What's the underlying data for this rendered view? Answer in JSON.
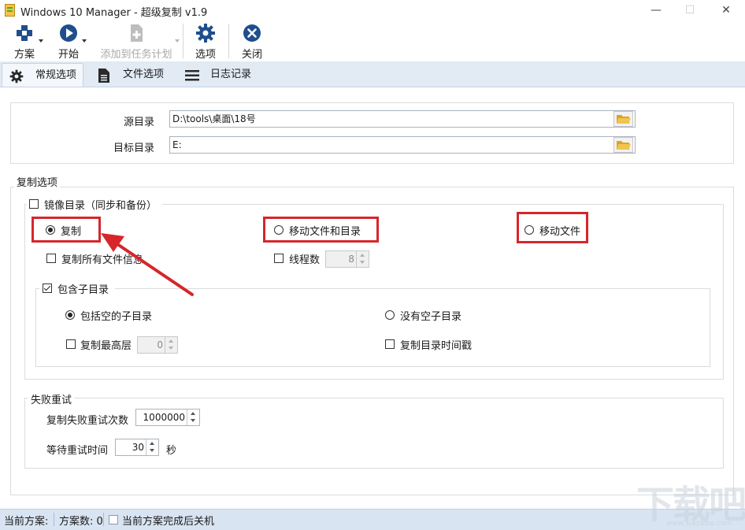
{
  "window": {
    "title": "Windows 10 Manager - 超级复制 v1.9",
    "minimize": "—",
    "maximize": "☐",
    "close": "✕"
  },
  "toolbar": {
    "scheme": "方案",
    "start": "开始",
    "add_task": "添加到任务计划",
    "options": "选项",
    "close": "关闭"
  },
  "tabs": {
    "general": "常规选项",
    "file_options": "文件选项",
    "log": "日志记录"
  },
  "paths": {
    "source_label": "源目录",
    "source_value": "D:\\tools\\桌面\\18号",
    "target_label": "目标目录",
    "target_value": "E:"
  },
  "copy_options": {
    "group_title": "复制选项",
    "mirror": "镜像目录（同步和备份）",
    "mode_copy": "复制",
    "mode_move_files_dirs": "移动文件和目录",
    "mode_move_files": "移动文件",
    "copy_all_info": "复制所有文件信息",
    "threads_label": "线程数",
    "threads_value": "8",
    "include_subdirs": "包含子目录",
    "include_empty": "包括空的子目录",
    "no_empty": "没有空子目录",
    "copy_max_level": "复制最高层",
    "max_level_value": "0",
    "copy_dir_timestamp": "复制目录时间戳"
  },
  "retry": {
    "group_title": "失败重试",
    "count_label": "复制失败重试次数",
    "count_value": "1000000",
    "wait_label": "等待重试时间",
    "wait_value": "30",
    "wait_unit": "秒"
  },
  "status": {
    "current_scheme": "当前方案:",
    "scheme_count": "方案数: 0",
    "shutdown": "当前方案完成后关机"
  },
  "watermark": {
    "logo": "下载吧",
    "url": "www.xiazaiba.com"
  },
  "colors": {
    "highlight": "#d6262b",
    "tab_bar": "#e2eaf4",
    "status_bar": "#d8e4f2",
    "icon_blue": "#1f4e8c"
  }
}
